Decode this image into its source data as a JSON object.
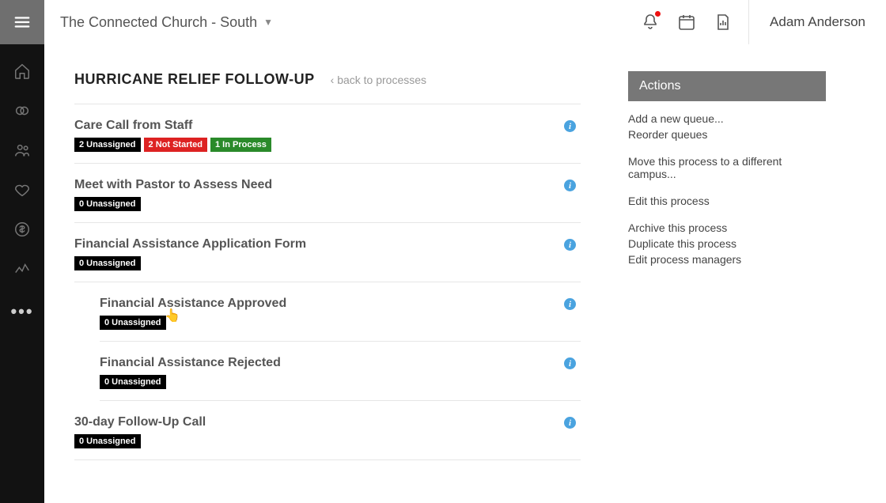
{
  "header": {
    "org_name": "The Connected Church - South",
    "user_name": "Adam Anderson"
  },
  "page": {
    "title": "HURRICANE RELIEF FOLLOW-UP",
    "back_label": "back to processes"
  },
  "queues": [
    {
      "title": "Care Call from Staff",
      "indent": 0,
      "badges": [
        {
          "kind": "unassigned",
          "text": "2 Unassigned"
        },
        {
          "kind": "notstarted",
          "text": "2 Not Started"
        },
        {
          "kind": "inprocess",
          "text": "1 In Process"
        }
      ]
    },
    {
      "title": "Meet with Pastor to Assess Need",
      "indent": 0,
      "badges": [
        {
          "kind": "unassigned",
          "text": "0 Unassigned"
        }
      ]
    },
    {
      "title": "Financial Assistance Application Form",
      "indent": 0,
      "badges": [
        {
          "kind": "unassigned",
          "text": "0 Unassigned"
        }
      ]
    },
    {
      "title": "Financial Assistance Approved",
      "indent": 1,
      "badges": [
        {
          "kind": "unassigned",
          "text": "0 Unassigned"
        }
      ]
    },
    {
      "title": "Financial Assistance Rejected",
      "indent": 1,
      "badges": [
        {
          "kind": "unassigned",
          "text": "0 Unassigned"
        }
      ]
    },
    {
      "title": "30-day Follow-Up Call",
      "indent": 0,
      "badges": [
        {
          "kind": "unassigned",
          "text": "0 Unassigned"
        }
      ]
    }
  ],
  "actions": {
    "panel_title": "Actions",
    "groups": [
      [
        "Add a new queue...",
        "Reorder queues"
      ],
      [
        "Move this process to a different campus..."
      ],
      [
        "Edit this process"
      ],
      [
        "Archive this process",
        "Duplicate this process",
        "Edit process managers"
      ]
    ]
  }
}
